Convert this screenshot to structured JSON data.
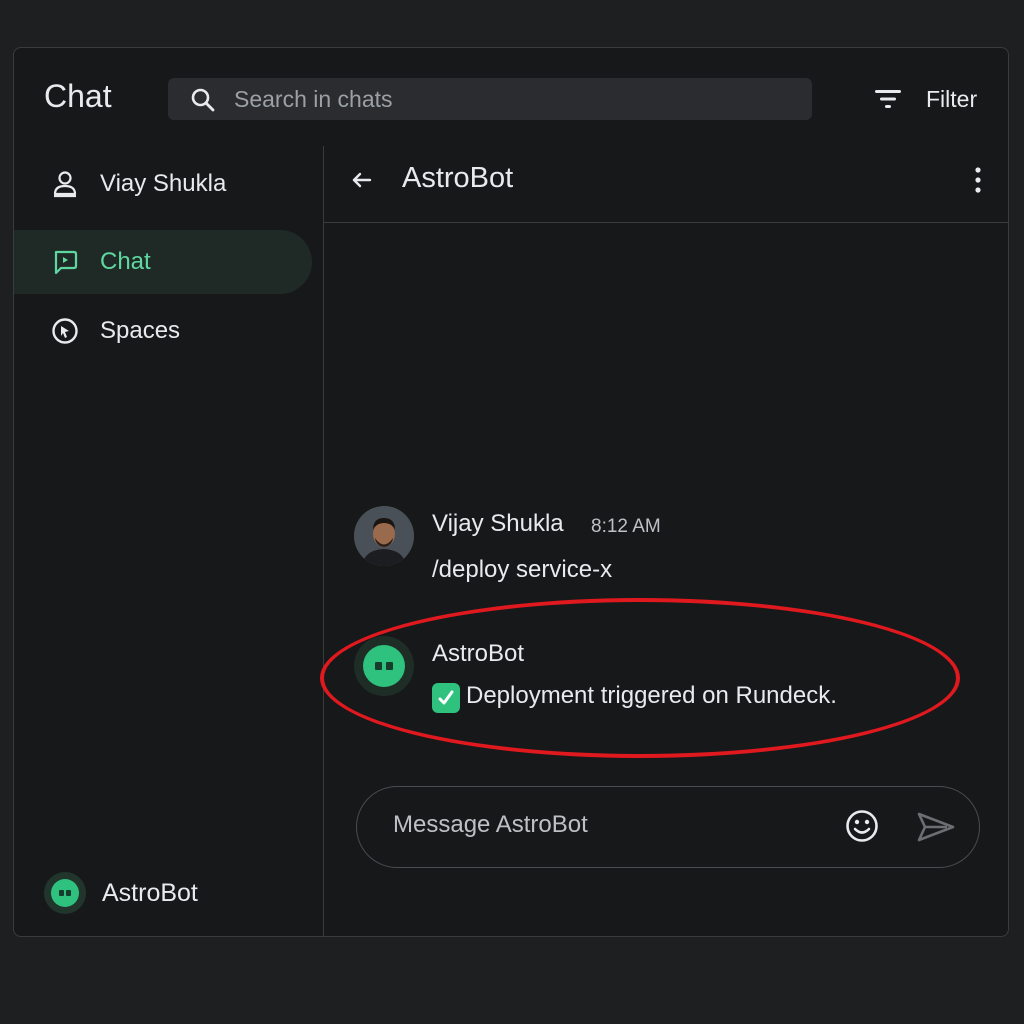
{
  "app": {
    "title": "Chat"
  },
  "search": {
    "placeholder": "Search in chats"
  },
  "filter": {
    "label": "Filter"
  },
  "sidebar": {
    "items": [
      {
        "label": "Viay Shukla",
        "icon": "person-icon",
        "active": false
      },
      {
        "label": "Chat",
        "icon": "chat-icon",
        "active": true
      },
      {
        "label": "Spaces",
        "icon": "spaces-icon",
        "active": false
      }
    ],
    "bottom_bot": {
      "label": "AstroBot",
      "icon": "bot-icon"
    }
  },
  "chat": {
    "title": "AstroBot",
    "messages": [
      {
        "sender": "Vijay Shukla",
        "time": "8:12 AM",
        "text": "/deploy service-x",
        "avatar": "user-photo"
      },
      {
        "sender": "AstroBot",
        "time": "",
        "text": "Deployment triggered on Rundeck.",
        "icon": "check-icon",
        "avatar": "bot-icon"
      }
    ]
  },
  "composer": {
    "placeholder": "Message AstroBot"
  },
  "colors": {
    "accent": "#5fd7a0",
    "bot_green": "#2ec27e",
    "highlight": "#e0191f",
    "background": "#17181a"
  }
}
